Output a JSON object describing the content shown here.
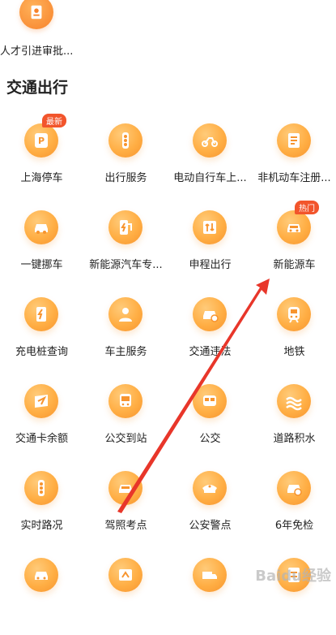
{
  "top_item": {
    "label": "人才引进审批..."
  },
  "section": {
    "title": "交通出行"
  },
  "tiles": [
    {
      "label": "上海停车",
      "icon": "parking-car-icon",
      "badge": "最新"
    },
    {
      "label": "出行服务",
      "icon": "traffic-light-icon"
    },
    {
      "label": "电动自行车上...",
      "icon": "e-bike-icon"
    },
    {
      "label": "非机动车注册...",
      "icon": "registration-doc-icon"
    },
    {
      "label": "一键挪车",
      "icon": "car-move-icon"
    },
    {
      "label": "新能源汽车专...",
      "icon": "ev-charger-icon"
    },
    {
      "label": "申程出行",
      "icon": "road-sign-icon"
    },
    {
      "label": "新能源车",
      "icon": "new-energy-car-icon",
      "badge": "热门"
    },
    {
      "label": "充电桩查询",
      "icon": "charging-pile-icon"
    },
    {
      "label": "车主服务",
      "icon": "car-owner-icon"
    },
    {
      "label": "交通违法",
      "icon": "traffic-violation-icon"
    },
    {
      "label": "地铁",
      "icon": "metro-icon"
    },
    {
      "label": "交通卡余额",
      "icon": "transport-card-icon"
    },
    {
      "label": "公交到站",
      "icon": "bus-arrival-icon"
    },
    {
      "label": "公交",
      "icon": "bus-icon"
    },
    {
      "label": "道路积水",
      "icon": "road-water-icon"
    },
    {
      "label": "实时路况",
      "icon": "realtime-traffic-icon"
    },
    {
      "label": "驾照考点",
      "icon": "exam-site-icon"
    },
    {
      "label": "公安警点",
      "icon": "police-cap-icon"
    },
    {
      "label": "6年免检",
      "icon": "inspection-exempt-icon"
    },
    {
      "label": "",
      "icon": "car-icon"
    },
    {
      "label": "",
      "icon": "map-icon"
    },
    {
      "label": "",
      "icon": "truck-icon"
    },
    {
      "label": "",
      "icon": "document-icon"
    }
  ],
  "watermark": "Baidu经验",
  "colors": {
    "accent": "#f7942e",
    "badge": "#f2552c",
    "arrow": "#e8362a"
  }
}
